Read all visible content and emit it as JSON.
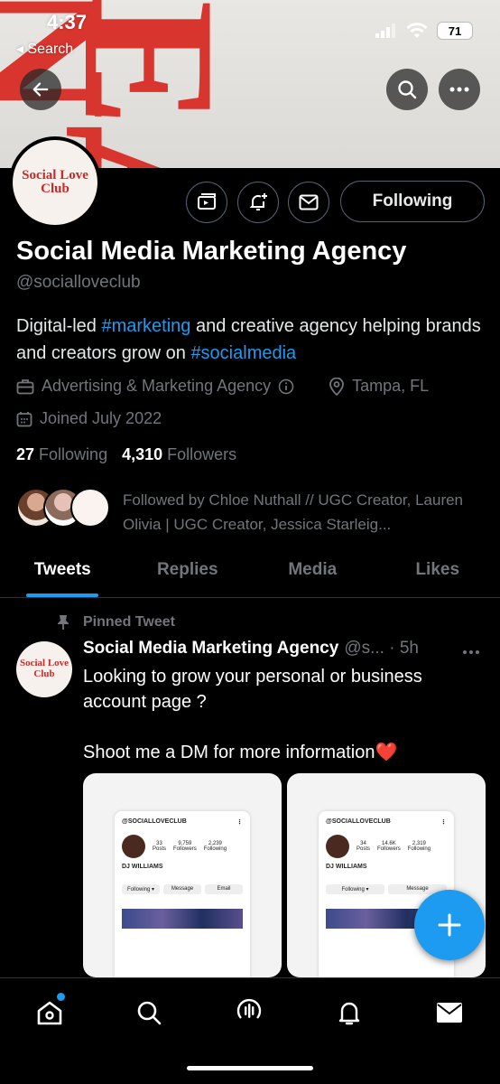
{
  "status_bar": {
    "time": "4:37",
    "back_label": "◂ Search",
    "battery": "71"
  },
  "banner": {
    "deco_text_1": "NTE",
    "deco_text_2": "EAT"
  },
  "profile": {
    "avatar_line1": "Social Love",
    "avatar_line2": "Club",
    "name": "Social Media Marketing Agency",
    "handle": "@socialloveclub",
    "bio_part1": "Digital-led ",
    "bio_tag1": "#marketing",
    "bio_part2": " and creative agency helping brands and creators grow on ",
    "bio_tag2": "#socialmedia",
    "category": "Advertising & Marketing Agency",
    "location": "Tampa, FL",
    "joined": "Joined July 2022",
    "following_count": "27",
    "following_label": "Following",
    "followers_count": "4,310",
    "followers_label": "Followers",
    "followed_by": "Followed by Chloe Nuthall // UGC Creator, Lauren Olivia | UGC Creator, Jessica Starleig...",
    "follow_button": "Following"
  },
  "tabs": [
    "Tweets",
    "Replies",
    "Media",
    "Likes"
  ],
  "tweet": {
    "pinned_label": "Pinned Tweet",
    "author": "Social Media Marketing Agency",
    "handle_time": "@s... · 5h",
    "text_line1": "Looking to grow your personal or business account page ?",
    "text_line2": "Shoot me a DM for more information❤️",
    "media": [
      {
        "account": "@SOCIALLOVECLUB",
        "posts": "33",
        "followers": "9,759",
        "following": "2,239",
        "name": "DJ WILLIAMS"
      },
      {
        "account": "@SOCIALLOVECLUB",
        "posts": "34",
        "followers": "14.6K",
        "following": "2,319",
        "name": "DJ WILLIAMS"
      }
    ]
  },
  "colors": {
    "accent": "#1d9bf0",
    "background": "#000000",
    "muted": "#71767b"
  }
}
